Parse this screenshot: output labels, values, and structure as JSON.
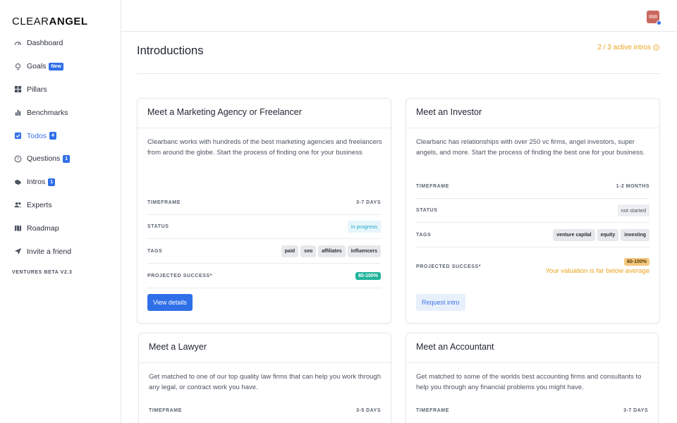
{
  "brand": {
    "light": "CLEAR",
    "bold": "ANGEL"
  },
  "sidebar": {
    "items": [
      {
        "label": "Dashboard",
        "icon": "dashboard-icon"
      },
      {
        "label": "Goals",
        "icon": "lightbulb-icon",
        "badge": "New"
      },
      {
        "label": "Pillars",
        "icon": "grid-icon"
      },
      {
        "label": "Benchmarks",
        "icon": "bar-chart-icon"
      },
      {
        "label": "Todos",
        "icon": "checkbox-icon",
        "badge": "4"
      },
      {
        "label": "Questions",
        "icon": "question-icon",
        "badge": "1"
      },
      {
        "label": "Intros",
        "icon": "handshake-icon",
        "badge": "1"
      },
      {
        "label": "Experts",
        "icon": "people-icon"
      },
      {
        "label": "Roadmap",
        "icon": "map-icon"
      },
      {
        "label": "Invite a friend",
        "icon": "send-icon"
      }
    ],
    "version": "VENTURES BETA V2.3"
  },
  "header": {
    "title": "Introductions",
    "active_intros": "2 / 3 active intros"
  },
  "labels": {
    "timeframe": "TIMEFRAME",
    "status": "STATUS",
    "tags": "TAGS",
    "projected": "PROJECTED SUCCESS*"
  },
  "cards": [
    {
      "title": "Meet a Marketing Agency or Freelancer",
      "description": "Clearbanc works with hundreds of the best marketing agencies and freelancers from around the globe. Start the process of finding one for your business",
      "timeframe": "3-7 DAYS",
      "status": "in progress",
      "tags": [
        "paid",
        "seo",
        "affiliates",
        "influencers"
      ],
      "success": "80-100%",
      "success_color": "#1fb39a",
      "button": "View details"
    },
    {
      "title": "Meet an Investor",
      "description": "Clearbanc has relationships with over 250 vc firms, angel investors, super angels, and more. Start the process of finding the best one for your business.",
      "timeframe": "1-2 MONTHS",
      "status": "not started",
      "tags": [
        "venture capital",
        "equity",
        "investing"
      ],
      "success": "60-100%",
      "success_color": "#f5c77e",
      "warning": "Your valuation is far below average",
      "button": "Request intro"
    },
    {
      "title": "Meet a Lawyer",
      "description": "Get matched to one of our top quality law firms that can help you work through any legal, or contract work you have.",
      "timeframe": "3-5 DAYS"
    },
    {
      "title": "Meet an Accountant",
      "description": "Get matched to some of the worlds best accounting firms and consultants to help you through any financial problems you might have.",
      "timeframe": "3-7 DAYS"
    }
  ],
  "colors": {
    "accent": "#2f6fe8",
    "warning": "#eaa21c",
    "teal": "#1fb39a"
  }
}
